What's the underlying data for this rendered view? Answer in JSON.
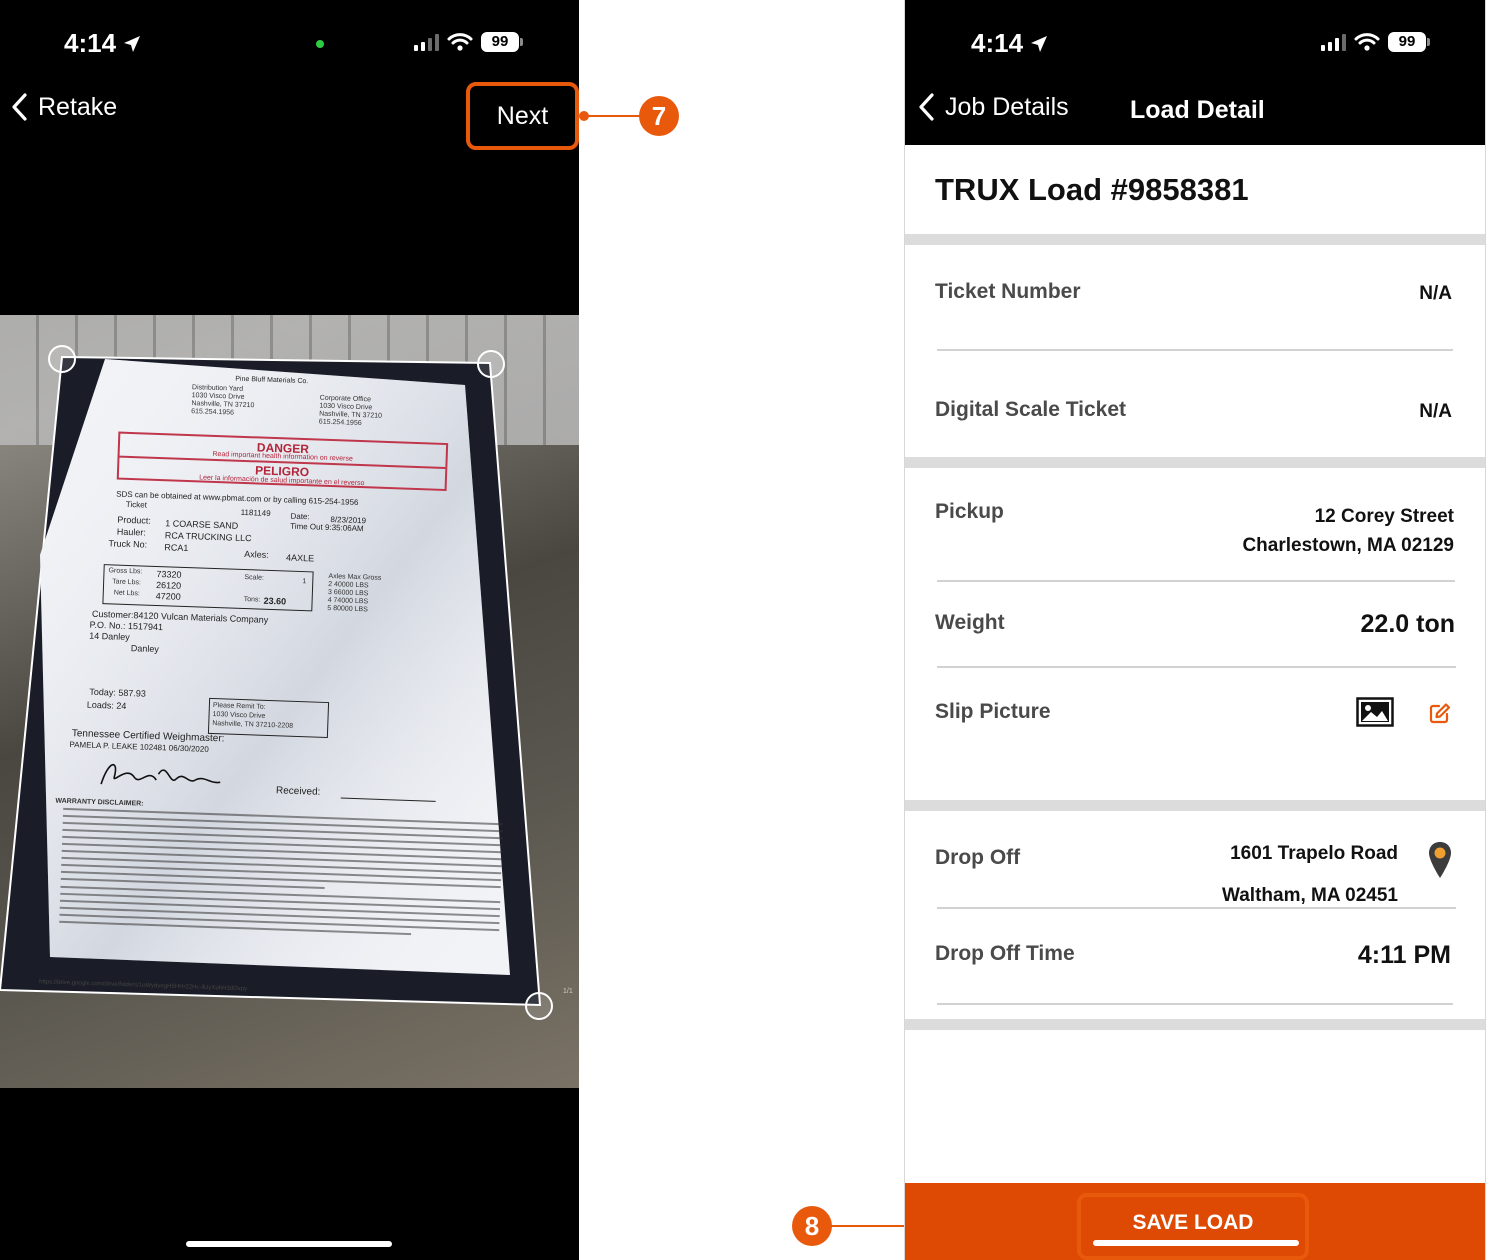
{
  "left_screen": {
    "status": {
      "time": "4:14",
      "battery": "99"
    },
    "nav": {
      "back_label": "Retake",
      "next_label": "Next"
    },
    "ticket": {
      "company": "Pine Bluff Materials Co.",
      "yard_block": [
        "Distribution Yard",
        "1030 Visco Drive",
        "Nashville, TN 37210",
        "615.254.1956"
      ],
      "office_block": [
        "Corporate Office",
        "1030 Visco Drive",
        "Nashville, TN 37210",
        "615.254.1956"
      ],
      "danger_title": "DANGER",
      "danger_sub": "Read important health information on reverse",
      "peligro_title": "PELIGRO",
      "peligro_sub": "Leer la información de salud importante en el reverso",
      "sds_line": "SDS can be obtained at www.pbmat.com or by calling 615-254-1956",
      "ticket_label": "Ticket",
      "ticket_no": "1181149",
      "date_label": "Date:",
      "date_value": "8/23/2019",
      "time_out": "Time Out 9:35:06AM",
      "product_label": "Product:",
      "product_value": "1        COARSE SAND",
      "hauler_label": "Hauler:",
      "hauler_value": "RCA TRUCKING LLC",
      "truck_label": "Truck No:",
      "truck_value": "RCA1",
      "axles_label": "Axles:",
      "axles_value": "4AXLE",
      "gross_label": "Gross Lbs:",
      "gross_value": "73320",
      "tare_label": "Tare Lbs:",
      "tare_value": "26120",
      "net_label": "Net Lbs:",
      "net_value": "47200",
      "scale_label": "Scale:",
      "scale_value": "1",
      "tons_label": "Tons:",
      "tons_value": "23.60",
      "axles_max_title": "Axles Max Gross",
      "axles_max_rows": [
        "2    40000 LBS",
        "3    66000 LBS",
        "4    74000 LBS",
        "5    80000 LBS"
      ],
      "customer_line": "Customer:84120     Vulcan Materials Company",
      "po_line": "P.O. No.: 1517941",
      "po_extra_1": "14          Danley",
      "po_extra_2": "Danley",
      "today_line": "Today:   587.93",
      "loads_line": "Loads:   24",
      "remit_lines": [
        "Please Remit To:",
        "1030 Visco Drive",
        "Nashville, TN 37210-2208"
      ],
      "weighmaster": "Tennessee Certified Weighmaster:",
      "weighmaster_name": "PAMELA P. LEAKE 102481 06/30/2020",
      "received_label": "Received:",
      "warranty_heading": "WARRANTY DISCLAIMER:",
      "footer_url": "https://drive.google.com/drive/folders/1oWydyegH5HHr22Hc-ilUyXuhH3dOxpy",
      "page_no": "1/1"
    }
  },
  "right_screen": {
    "status": {
      "time": "4:14",
      "battery": "99"
    },
    "nav": {
      "back_label": "Job Details",
      "title": "Load Detail"
    },
    "load_title": "TRUX Load #9858381",
    "rows": {
      "ticket_number": {
        "label": "Ticket Number",
        "value": "N/A"
      },
      "digital_scale_ticket": {
        "label": "Digital Scale Ticket",
        "value": "N/A"
      },
      "pickup": {
        "label": "Pickup",
        "line1": "12 Corey Street",
        "line2": "Charlestown, MA 02129"
      },
      "weight": {
        "label": "Weight",
        "value": "22.0 ton"
      },
      "slip_picture": {
        "label": "Slip Picture"
      },
      "drop_off": {
        "label": "Drop Off",
        "line1": "1601 Trapelo Road",
        "line2": "Waltham, MA 02451"
      },
      "drop_off_time": {
        "label": "Drop Off Time",
        "value": "4:11 PM"
      }
    },
    "save_label": "SAVE LOAD"
  },
  "callouts": {
    "step_next": "7",
    "step_save": "8"
  },
  "colors": {
    "accent": "#e8590c",
    "save_bar": "#de4a04",
    "header_bg": "#000000",
    "separator": "#dcdcdc"
  },
  "icons": [
    "location-arrow-icon",
    "signal-icon",
    "wifi-icon",
    "battery-icon",
    "chevron-left-icon",
    "image-icon",
    "edit-icon",
    "map-pin-icon"
  ]
}
